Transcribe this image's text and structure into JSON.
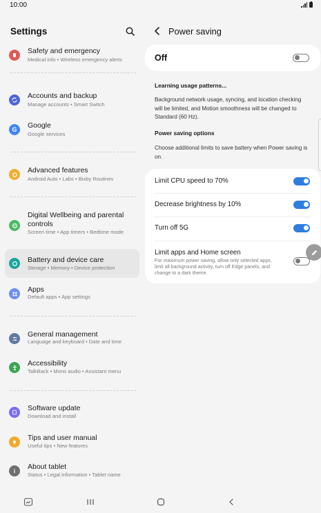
{
  "status_bar": {
    "time": "10:00"
  },
  "settings": {
    "title": "Settings",
    "items": [
      {
        "title": "Safety and emergency",
        "subtitle": "Medical info  •  Wireless emergency alerts",
        "icon": "safety-icon",
        "color": "#e05a57"
      },
      {
        "title": "Accounts and backup",
        "subtitle": "Manage accounts  •  Smart Switch",
        "icon": "sync-icon",
        "color": "#4a67d6"
      },
      {
        "title": "Google",
        "subtitle": "Google services",
        "icon": "google-icon",
        "color": "#3f86f0"
      },
      {
        "title": "Advanced features",
        "subtitle": "Android Auto  •  Labs  •  Bixby Routines",
        "icon": "star-gear-icon",
        "color": "#f0ae2d"
      },
      {
        "title": "Digital Wellbeing and parental controls",
        "subtitle": "Screen time  •  App timers  •  Bedtime mode",
        "icon": "wellbeing-icon",
        "color": "#4cbb63"
      },
      {
        "title": "Battery and device care",
        "subtitle": "Storage  •  Memory  •  Device protection",
        "icon": "device-care-icon",
        "color": "#1ba49c"
      },
      {
        "title": "Apps",
        "subtitle": "Default apps  •  App settings",
        "icon": "apps-icon",
        "color": "#6e8ff0"
      },
      {
        "title": "General management",
        "subtitle": "Language and keyboard  •  Date and time",
        "icon": "sliders-icon",
        "color": "#5e7aa2"
      },
      {
        "title": "Accessibility",
        "subtitle": "TalkBack  •  Mono audio  •  Assistant menu",
        "icon": "accessibility-icon",
        "color": "#3ca354"
      },
      {
        "title": "Software update",
        "subtitle": "Download and install",
        "icon": "software-update-icon",
        "color": "#7b6df0"
      },
      {
        "title": "Tips and user manual",
        "subtitle": "Useful tips  •  New features",
        "icon": "bulb-icon",
        "color": "#f1a92e"
      },
      {
        "title": "About tablet",
        "subtitle": "Status  •  Legal information  •  Tablet name",
        "icon": "info-icon",
        "color": "#6f6f6f"
      }
    ]
  },
  "power_saving": {
    "title": "Power saving",
    "master_label": "Off",
    "master_on": false,
    "learning_title": "Learning usage patterns...",
    "learning_body": "Background network usage, syncing, and location checking will be limited, and Motion smoothness will be changed to Standard (60 Hz).",
    "options_title": "Power saving options",
    "options_body": "Choose additional limits to save battery when Power saving is on.",
    "options": [
      {
        "label": "Limit CPU speed to 70%",
        "on": true
      },
      {
        "label": "Decrease brightness by 10%",
        "on": true
      },
      {
        "label": "Turn off 5G",
        "on": true
      }
    ],
    "limit_apps": {
      "label": "Limit apps and Home screen",
      "description": "For maximum power saving, allow only selected apps, limit all background activity, turn off Edge panels, and change to a dark theme.",
      "on": false
    }
  },
  "colors": {
    "accent": "#2f7de1",
    "selected_row": "#e7e7e7",
    "background": "#f4f4f4"
  }
}
